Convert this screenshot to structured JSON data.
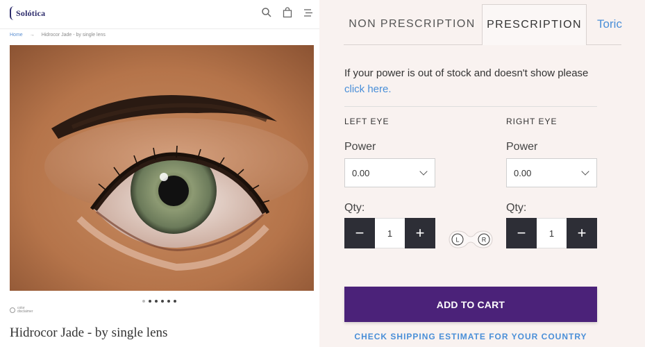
{
  "header": {
    "logo_text": "Solótica",
    "icons": [
      "search-icon",
      "bag-icon",
      "menu-icon"
    ]
  },
  "breadcrumb": {
    "home": "Home",
    "separator": "→",
    "current": "Hidrocor Jade - by single lens"
  },
  "gallery": {
    "dot_count": 6,
    "active_dot": 0
  },
  "disclaimer": {
    "line1": "color",
    "line2": "disclaimer"
  },
  "product": {
    "title": "Hidrocor Jade - by single lens"
  },
  "tabs": {
    "non_prescription": "NON PRESCRIPTION",
    "prescription": "PRESCRIPTION",
    "toric": "Toric",
    "active": "prescription"
  },
  "stock_notice": {
    "text_before": "If your power is out of stock and doesn't show please ",
    "link": "click here."
  },
  "left_eye": {
    "heading": "LEFT EYE",
    "power_label": "Power",
    "power_value": "0.00",
    "qty_label": "Qty:",
    "qty_value": "1"
  },
  "right_eye": {
    "heading": "RIGHT EYE",
    "power_label": "Power",
    "power_value": "0.00",
    "qty_label": "Qty:",
    "qty_value": "1"
  },
  "case_icon": {
    "left": "L",
    "right": "R"
  },
  "stepper": {
    "minus": "−",
    "plus": "+"
  },
  "actions": {
    "add_to_cart": "ADD TO CART",
    "shipping_estimate": "CHECK SHIPPING ESTIMATE FOR YOUR COUNTRY"
  },
  "colors": {
    "brand_purple": "#4b2279",
    "link_blue": "#4a8fd8",
    "panel_bg": "#f9f2f0",
    "stepper_dark": "#2d2e36"
  }
}
